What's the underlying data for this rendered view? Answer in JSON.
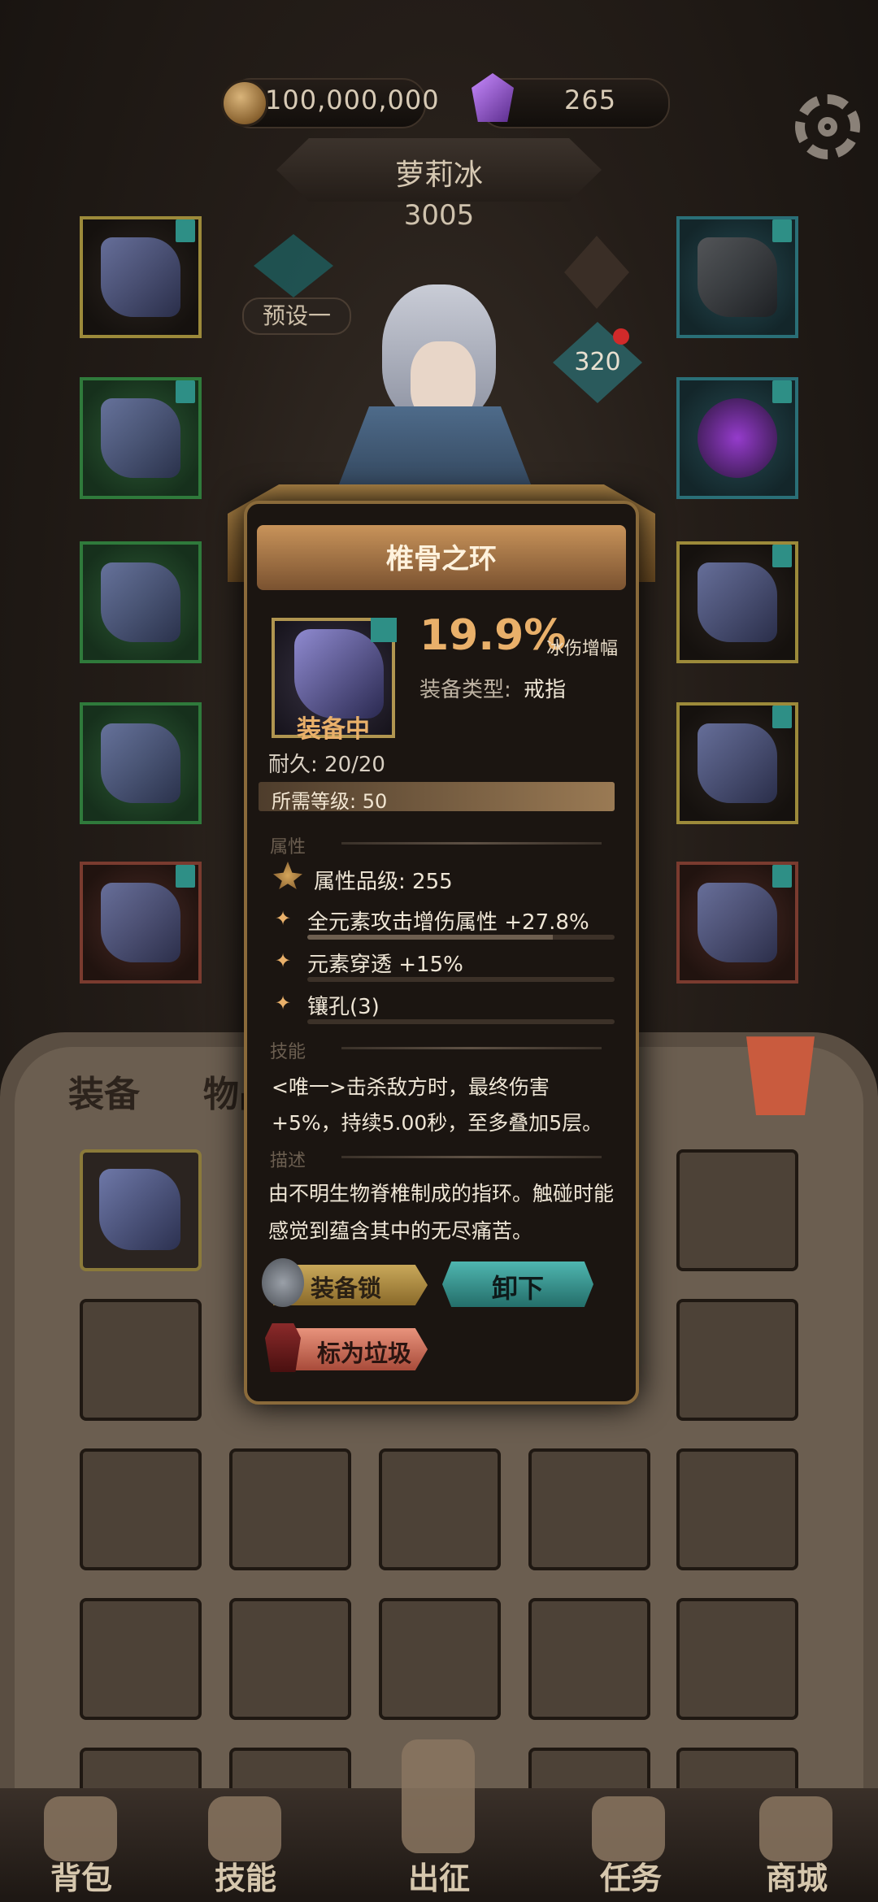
{
  "topbar": {
    "gold": "100,000,000",
    "gems": "265"
  },
  "character": {
    "name": "萝莉冰",
    "power": "3005",
    "preset_label": "预设一",
    "level_badge": "320"
  },
  "tooltip": {
    "title": "椎骨之环",
    "equipped_label": "装备中",
    "main_value": "19.9%",
    "main_value_label": "冰伤增幅",
    "type_key": "装备类型:",
    "type_value": "戒指",
    "durability": "耐久: 20/20",
    "required_level": "所需等级: 50",
    "sections": {
      "attributes": "属性",
      "skill": "技能",
      "description": "描述"
    },
    "attribute_grade": "属性品级: 255",
    "affixes": [
      {
        "text": "全元素攻击增伤属性 +27.8%",
        "fill": 0.8
      },
      {
        "text": "元素穿透 +15%",
        "fill": 0.0
      },
      {
        "text": "镶孔(3)",
        "fill": 0.0
      }
    ],
    "skill_text": "<唯一>击杀敌方时，最终伤害+5%，持续5.00秒，至多叠加5层。",
    "description_text": "由不明生物脊椎制成的指环。触碰时能感觉到蕴含其中的无尽痛苦。",
    "buttons": {
      "lock": "装备锁",
      "unequip": "卸下",
      "mark_trash": "标为垃圾"
    }
  },
  "inventory_tabs": {
    "equipment": "装备",
    "items": "物品"
  },
  "nav": {
    "bag": "背包",
    "skills": "技能",
    "expedition": "出征",
    "quests": "任务",
    "shop": "商城"
  }
}
